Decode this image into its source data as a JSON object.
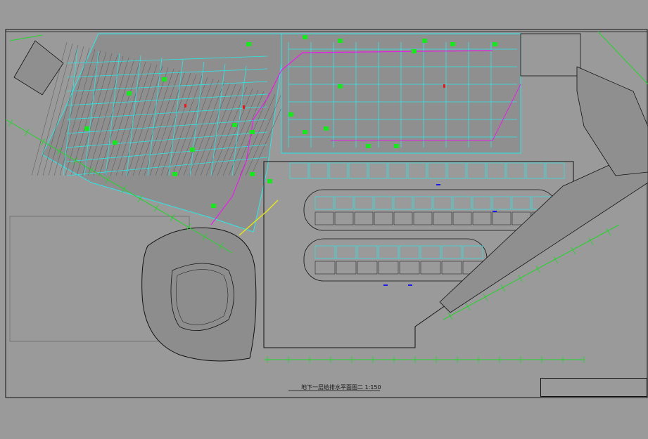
{
  "drawing": {
    "title": "地下一层给排水平面图二  1:150",
    "legend_notes": [
      "",
      ""
    ],
    "colors": {
      "background": "#9a9a9a",
      "wall": "#2ee6e6",
      "pipe_green": "#19e61f",
      "pipe_magenta": "#e61fe6",
      "pipe_yellow": "#e6e61a",
      "pipe_blue": "#1a1ae6",
      "pipe_red": "#e61a1a",
      "linework": "#1a1a1a",
      "dim_line": "#22d42b"
    },
    "icons": [
      "parking-grid",
      "stair-symbol",
      "sprinkler-symbol",
      "drain-symbol"
    ],
    "title_block": {
      "rows": [
        "",
        "",
        ""
      ]
    }
  }
}
